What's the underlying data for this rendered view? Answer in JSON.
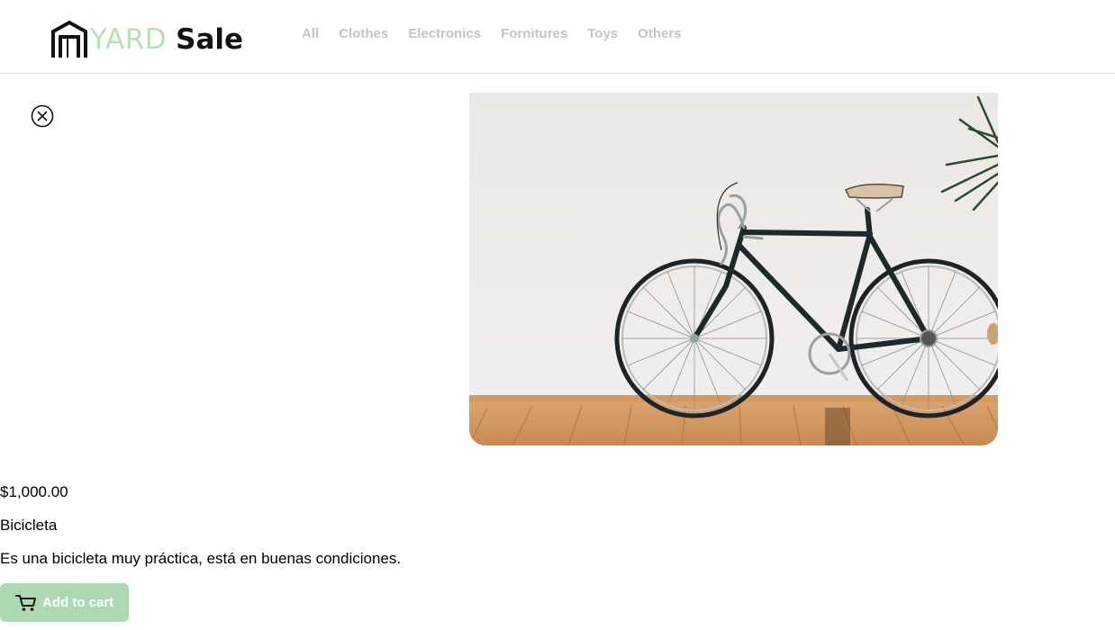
{
  "header": {
    "logo": {
      "part1": "YARD",
      "part2": "Sale",
      "icon": "garage-icon"
    },
    "nav": [
      {
        "label": "All"
      },
      {
        "label": "Clothes"
      },
      {
        "label": "Electronics"
      },
      {
        "label": "Fornitures"
      },
      {
        "label": "Toys"
      },
      {
        "label": "Others"
      }
    ]
  },
  "product": {
    "close_icon": "close-circle-icon",
    "image_subject": "bicycle",
    "price": "$1,000.00",
    "name": "Bicicleta",
    "description": "Es una bicicleta muy práctica, está en buenas condiciones.",
    "add_to_cart_label": "Add to cart",
    "cart_icon": "cart-icon"
  },
  "colors": {
    "accent_green": "#acd9b2",
    "logo_green": "#b7dfb8",
    "nav_text": "#c4c4c4"
  }
}
